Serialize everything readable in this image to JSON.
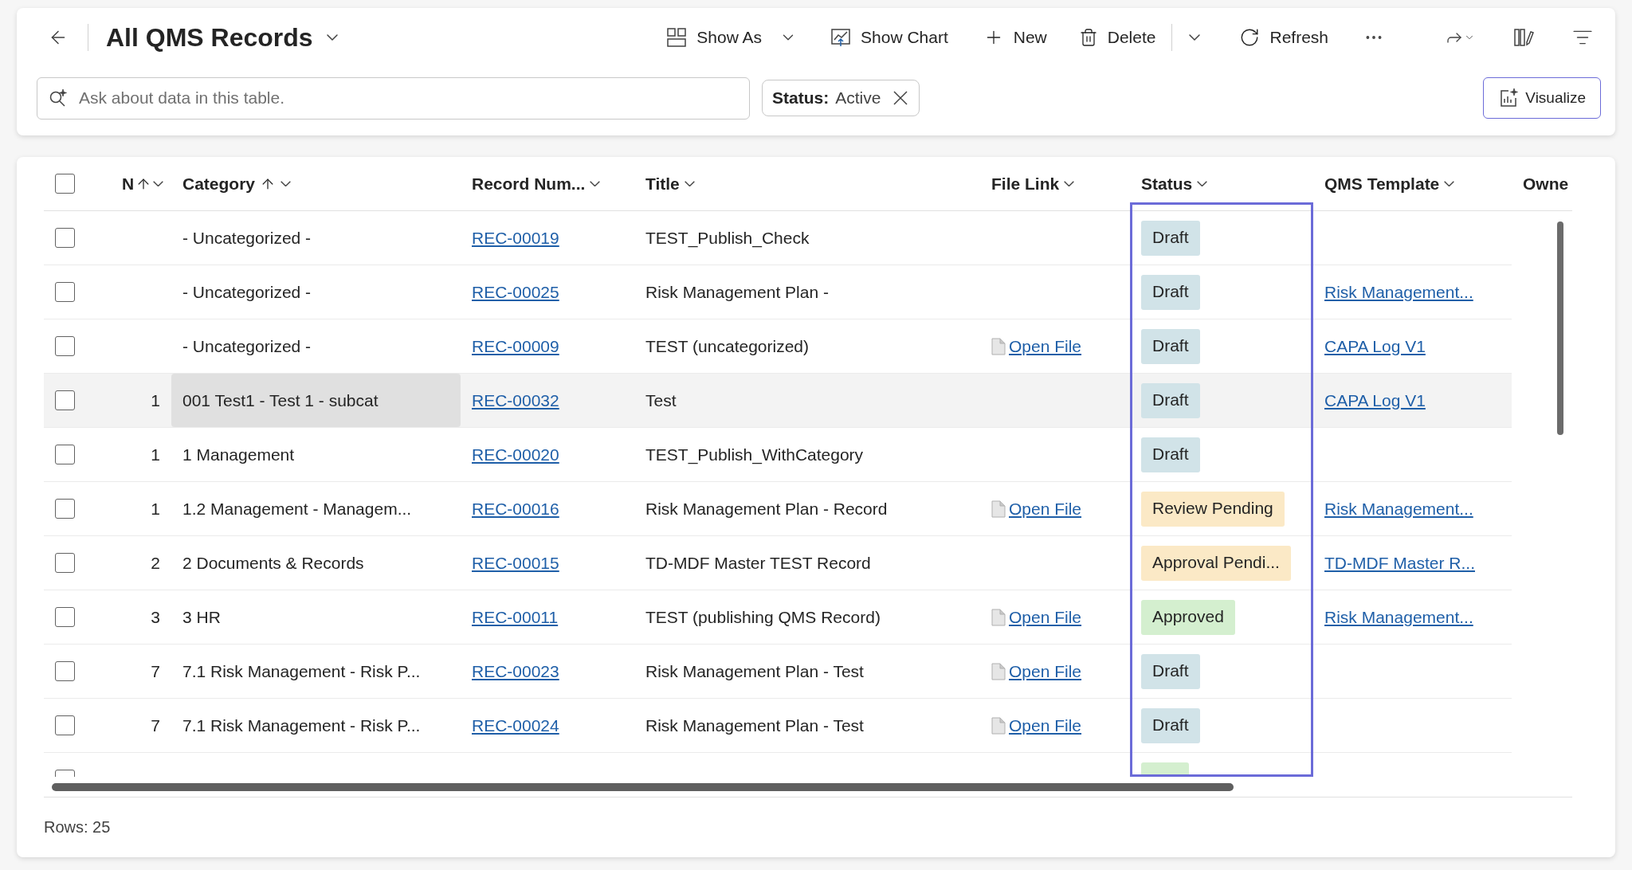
{
  "header": {
    "title": "All QMS Records"
  },
  "toolbar": [
    {
      "kind": "show_as",
      "label": "Show As"
    },
    {
      "kind": "show_chart",
      "label": "Show Chart"
    },
    {
      "kind": "new",
      "label": "New"
    },
    {
      "kind": "delete",
      "label": "Delete"
    },
    {
      "kind": "split"
    },
    {
      "kind": "refresh",
      "label": "Refresh"
    },
    {
      "kind": "more"
    },
    {
      "kind": "share"
    },
    {
      "kind": "columns"
    },
    {
      "kind": "filter"
    }
  ],
  "search": {
    "placeholder": "Ask about data in this table."
  },
  "filter_chip": {
    "name": "Status:",
    "value": "Active"
  },
  "visualize": {
    "label": "Visualize"
  },
  "select_all_checked": false,
  "columns": [
    {
      "label": "N",
      "sorted": true,
      "highlighted": false
    },
    {
      "label": "Category",
      "sorted": true,
      "highlighted": false
    },
    {
      "label": "Record Num...",
      "sorted": false,
      "highlighted": false
    },
    {
      "label": "Title",
      "sorted": false,
      "highlighted": false
    },
    {
      "label": "File Link",
      "sorted": false,
      "highlighted": false
    },
    {
      "label": "Status",
      "sorted": false,
      "highlighted": true
    },
    {
      "label": "QMS Template",
      "sorted": false,
      "highlighted": false
    },
    {
      "label": "Owne"
    }
  ],
  "rows": [
    {
      "checked": false,
      "hovered": false,
      "category_focused": false,
      "category": "- Uncategorized -",
      "record": "REC-00019",
      "title": "TEST_Publish_Check",
      "status": {
        "label": "Draft",
        "color": "#d1e3e8"
      }
    },
    {
      "checked": false,
      "hovered": false,
      "category_focused": false,
      "category": "- Uncategorized -",
      "record": "REC-00025",
      "title": "Risk Management Plan -",
      "status": {
        "label": "Draft",
        "color": "#d1e3e8"
      },
      "template": "Risk Management..."
    },
    {
      "checked": false,
      "hovered": false,
      "category_focused": false,
      "category": "- Uncategorized -",
      "record": "REC-00009",
      "title": "TEST (uncategorized)",
      "file": "Open File",
      "status": {
        "label": "Draft",
        "color": "#d1e3e8"
      },
      "template": "CAPA Log V1"
    },
    {
      "checked": false,
      "hovered": true,
      "category_focused": true,
      "number": "1",
      "category": "001 Test1 - Test 1 - subcat",
      "record": "REC-00032",
      "title": "Test",
      "status": {
        "label": "Draft",
        "color": "#d1e3e8"
      },
      "template": "CAPA Log V1"
    },
    {
      "checked": false,
      "hovered": false,
      "category_focused": false,
      "number": "1",
      "category": "1 Management",
      "record": "REC-00020",
      "title": "TEST_Publish_WithCategory",
      "status": {
        "label": "Draft",
        "color": "#d1e3e8"
      }
    },
    {
      "checked": false,
      "hovered": false,
      "category_focused": false,
      "number": "1",
      "category": "1.2 Management - Managem...",
      "record": "REC-00016",
      "title": "Risk Management Plan - Record",
      "file": "Open File",
      "status": {
        "label": "Review Pending",
        "color": "#fbe9c6"
      },
      "template": "Risk Management..."
    },
    {
      "checked": false,
      "hovered": false,
      "category_focused": false,
      "number": "2",
      "category": "2 Documents & Records",
      "record": "REC-00015",
      "title": "TD-MDF Master TEST Record",
      "status": {
        "label": "Approval Pendi...",
        "color": "#fbe9c6"
      },
      "template": "TD-MDF Master R..."
    },
    {
      "checked": false,
      "hovered": false,
      "category_focused": false,
      "number": "3",
      "category": "3 HR",
      "record": "REC-00011",
      "title": "TEST (publishing QMS Record)",
      "file": "Open File",
      "status": {
        "label": "Approved",
        "color": "#d4efcf"
      },
      "template": "Risk Management..."
    },
    {
      "checked": false,
      "hovered": false,
      "category_focused": false,
      "number": "7",
      "category": "7.1 Risk Management - Risk P...",
      "record": "REC-00023",
      "title": "Risk Management Plan - Test",
      "file": "Open File",
      "status": {
        "label": "Draft",
        "color": "#d1e3e8"
      }
    },
    {
      "checked": false,
      "hovered": false,
      "category_focused": false,
      "number": "7",
      "category": "7.1 Risk Management - Risk P...",
      "record": "REC-00024",
      "title": "Risk Management Plan - Test",
      "file": "Open File",
      "status": {
        "label": "Draft",
        "color": "#d1e3e8"
      }
    },
    {
      "hovered": false,
      "category_focused": false,
      "status": {
        "color": "#d4efcf"
      }
    }
  ],
  "footer": {
    "rows_label": "Rows: 25"
  }
}
